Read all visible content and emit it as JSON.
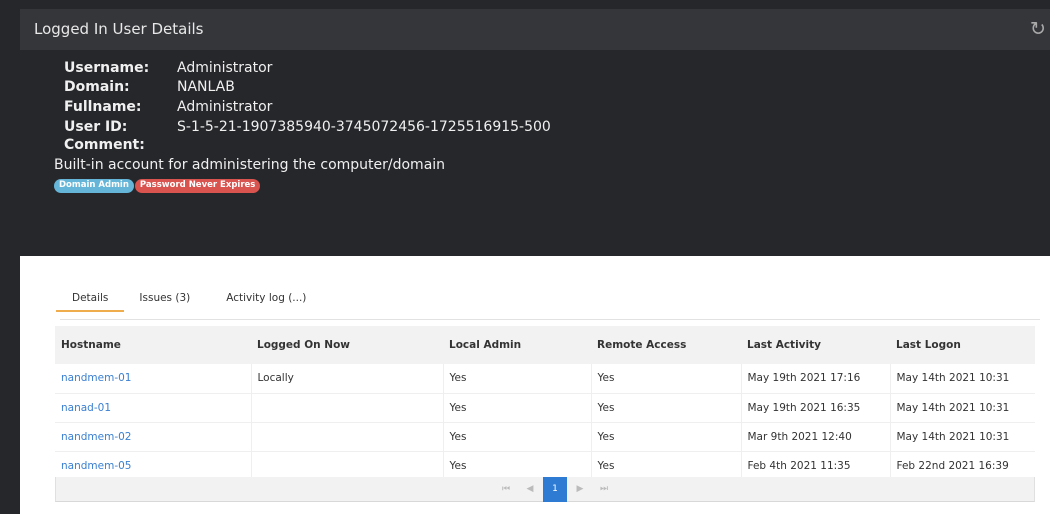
{
  "header": {
    "title": "Logged In User Details",
    "refresh_icon": "refresh-icon"
  },
  "user": {
    "fields": [
      {
        "label": "Username:",
        "value": "Administrator"
      },
      {
        "label": "Domain:",
        "value": "NANLAB"
      },
      {
        "label": "Fullname:",
        "value": "Administrator"
      },
      {
        "label": "User ID:",
        "value": "S-1-5-21-1907385940-3745072456-1725516915-500"
      }
    ],
    "comment_label": "Comment:",
    "comment_value": "Built-in account for administering the computer/domain",
    "badges": [
      {
        "label": "Domain Admin",
        "color": "#64b5d8"
      },
      {
        "label": "Password Never Expires",
        "color": "#d9534f"
      }
    ]
  },
  "tabs": [
    {
      "label": "Details",
      "active": true
    },
    {
      "label": "Issues (3)",
      "active": false
    },
    {
      "label": "Activity log (...)",
      "active": false
    }
  ],
  "table": {
    "columns": [
      "Hostname",
      "Logged On Now",
      "Local Admin",
      "Remote Access",
      "Last Activity",
      "Last Logon"
    ],
    "rows": [
      [
        "nandmem-01",
        "Locally",
        "Yes",
        "Yes",
        "May 19th 2021 17:16",
        "May 14th 2021 10:31"
      ],
      [
        "nanad-01",
        "",
        "Yes",
        "Yes",
        "May 19th 2021 16:35",
        "May 14th 2021 10:31"
      ],
      [
        "nandmem-02",
        "",
        "Yes",
        "Yes",
        "Mar 9th 2021 12:40",
        "May 14th 2021 10:31"
      ],
      [
        "nandmem-05",
        "",
        "Yes",
        "Yes",
        "Feb 4th 2021 11:35",
        "Feb 22nd 2021 16:39"
      ]
    ]
  },
  "pager": {
    "first": "⏮",
    "prev": "◀",
    "current": "1",
    "next": "▶",
    "last": "⏭"
  },
  "colors": {
    "accent_tab": "#f0ad4e",
    "link": "#3a7fd0",
    "pager_active": "#2d7bd3"
  }
}
